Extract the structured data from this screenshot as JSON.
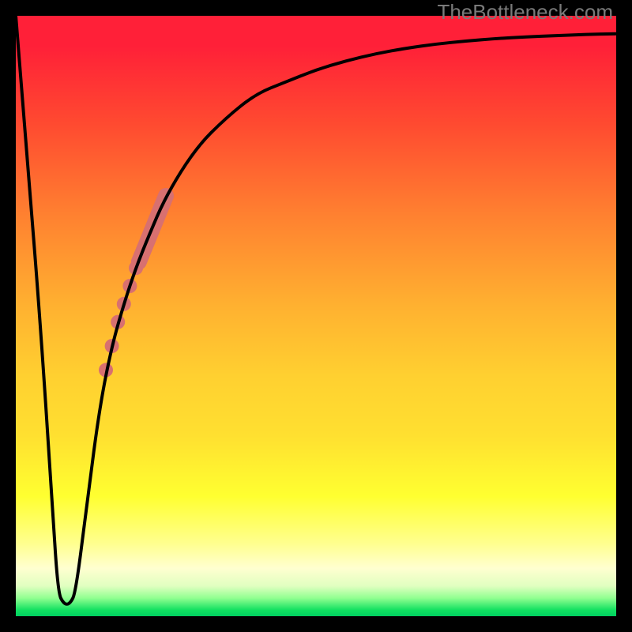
{
  "attribution": "TheBottleneck.com",
  "chart_data": {
    "type": "line",
    "title": "",
    "xlabel": "",
    "ylabel": "",
    "xlim": [
      0,
      100
    ],
    "ylim": [
      0,
      100
    ],
    "background_gradient": {
      "top": "#ff2038",
      "bottom": "#00d060",
      "description": "red-orange-yellow-green vertical gradient (bottleneck severity)"
    },
    "series": [
      {
        "name": "bottleneck-curve",
        "color": "#000000",
        "stroke_width": 4,
        "x": [
          0,
          2,
          4,
          6,
          7,
          8,
          9,
          10,
          12,
          14,
          16,
          18,
          20,
          22,
          25,
          30,
          35,
          40,
          45,
          50,
          55,
          60,
          65,
          70,
          75,
          80,
          85,
          90,
          95,
          100
        ],
        "y": [
          100,
          75,
          50,
          20,
          4,
          2,
          2,
          4,
          20,
          35,
          45,
          52,
          58,
          63,
          70,
          78,
          83,
          87,
          89,
          91,
          92.5,
          93.7,
          94.6,
          95.3,
          95.8,
          96.2,
          96.5,
          96.7,
          96.9,
          97.0
        ]
      }
    ],
    "highlight_points": {
      "name": "user-range-highlight",
      "color": "#d87070",
      "radius": 10,
      "points": [
        {
          "x": 17,
          "y": 49
        },
        {
          "x": 18,
          "y": 52
        },
        {
          "x": 19,
          "y": 55
        },
        {
          "x": 20,
          "y": 58
        }
      ],
      "dense_segment": {
        "x_start": 20.5,
        "x_end": 25.0,
        "y_start": 59,
        "y_end": 70
      },
      "extra_points": [
        {
          "x": 15,
          "y": 41
        },
        {
          "x": 16,
          "y": 45
        }
      ]
    }
  }
}
